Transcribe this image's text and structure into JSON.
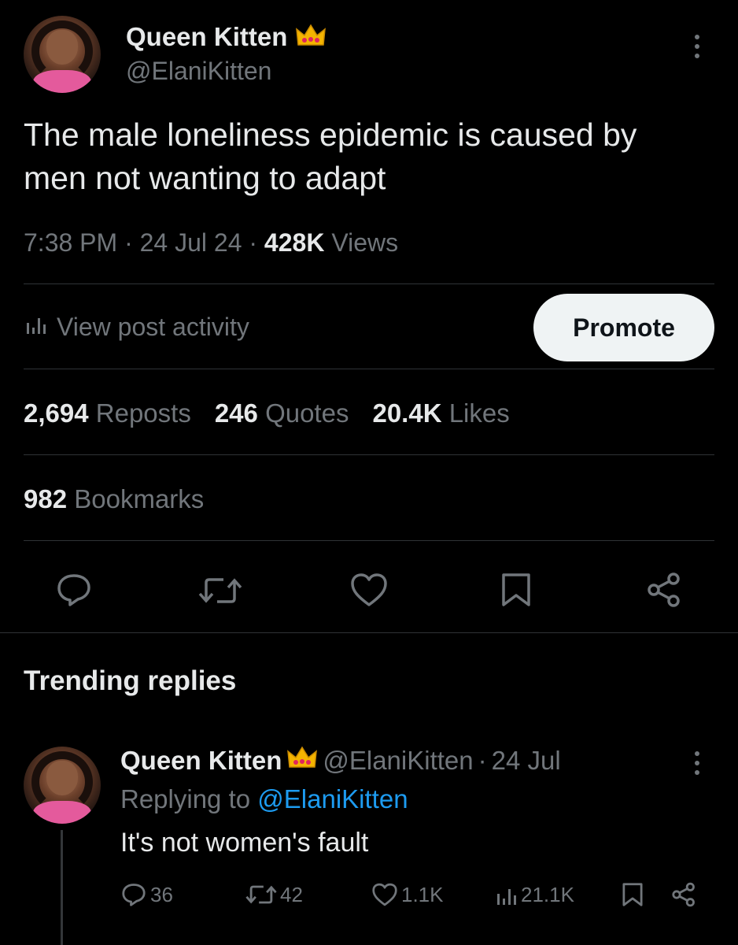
{
  "tweet": {
    "display_name": "Queen Kitten",
    "handle": "@ElaniKitten",
    "text_line1": "The male loneliness epidemic is caused by",
    "text_line2": "men not wanting to adapt",
    "time": "7:38 PM",
    "date": "24 Jul 24",
    "views_count": "428K",
    "views_label": "Views",
    "view_activity_label": "View post activity",
    "promote_label": "Promote",
    "reposts_count": "2,694",
    "reposts_label": "Reposts",
    "quotes_count": "246",
    "quotes_label": "Quotes",
    "likes_count": "20.4K",
    "likes_label": "Likes",
    "bookmarks_count": "982",
    "bookmarks_label": "Bookmarks",
    "icons": [
      "reply-icon",
      "repost-icon",
      "like-icon",
      "bookmark-icon",
      "share-icon"
    ]
  },
  "trending": {
    "heading": "Trending replies"
  },
  "reply": {
    "display_name": "Queen Kitten",
    "handle": "@ElaniKitten",
    "date": "24 Jul",
    "replying_prefix": "Replying to",
    "replying_handle": "@ElaniKitten",
    "text": "It's not women's fault",
    "replies": "36",
    "reposts": "42",
    "likes": "1.1K",
    "views": "21.1K"
  },
  "colors": {
    "background": "#000000",
    "text": "#e7e9ea",
    "muted": "#71767b",
    "link": "#1d9bf0",
    "divider": "#2f3336",
    "button": "#eff3f4"
  }
}
